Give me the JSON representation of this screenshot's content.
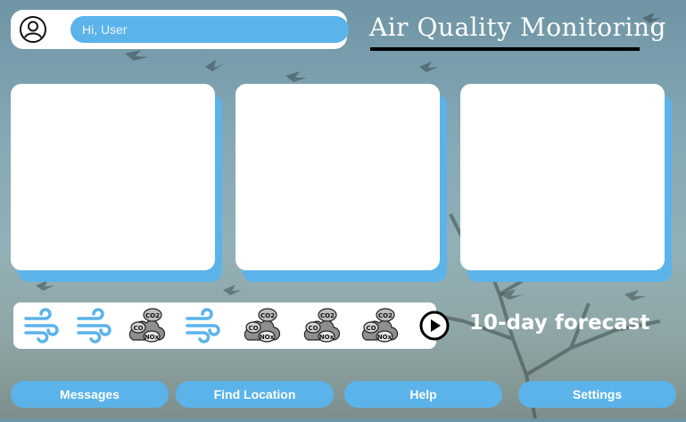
{
  "header": {
    "greeting": "Hi, User",
    "title": "Air Quality Monitoring"
  },
  "cards": [
    {
      "id": "card-1"
    },
    {
      "id": "card-2"
    },
    {
      "id": "card-3"
    }
  ],
  "forecast": {
    "label": "10-day forecast",
    "icons": [
      "wind-icon",
      "wind-icon",
      "pollution-cloud-icon",
      "wind-icon",
      "pollution-cloud-icon",
      "pollution-cloud-icon",
      "pollution-cloud-icon"
    ],
    "cloud_labels": {
      "co2": "CO2",
      "co": "CO",
      "nox": "NOx"
    }
  },
  "nav": {
    "messages": "Messages",
    "find_location": "Find Location",
    "help": "Help",
    "settings": "Settings"
  },
  "colors": {
    "accent": "#5bb3ea",
    "card": "#ffffff"
  }
}
